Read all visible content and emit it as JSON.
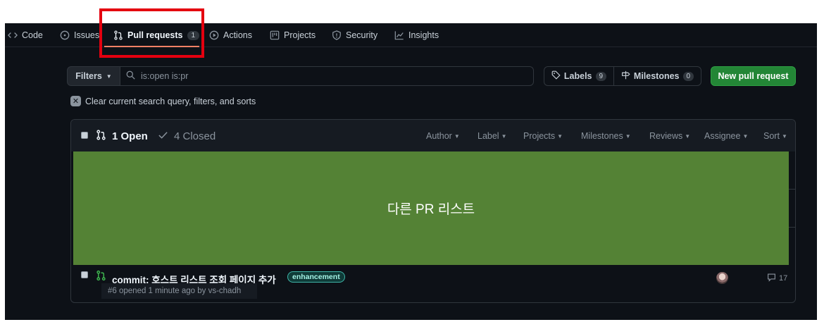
{
  "nav": {
    "items": [
      {
        "label": "Code",
        "icon": "code-icon"
      },
      {
        "label": "Issues",
        "icon": "issue-icon"
      },
      {
        "label": "Pull requests",
        "icon": "pull-request-icon",
        "count": "1",
        "active": true
      },
      {
        "label": "Actions",
        "icon": "play-icon"
      },
      {
        "label": "Projects",
        "icon": "project-icon"
      },
      {
        "label": "Security",
        "icon": "shield-icon"
      },
      {
        "label": "Insights",
        "icon": "graph-icon"
      }
    ]
  },
  "toolbar": {
    "filters_label": "Filters",
    "search_value": "is:open is:pr",
    "labels_label": "Labels",
    "labels_count": "9",
    "milestones_label": "Milestones",
    "milestones_count": "0",
    "new_pr_label": "New pull request"
  },
  "clear_filters": "Clear current search query, filters, and sorts",
  "list": {
    "open_label": "1 Open",
    "closed_label": "4 Closed",
    "filters": [
      "Author",
      "Label",
      "Projects",
      "Milestones",
      "Reviews",
      "Assignee",
      "Sort"
    ],
    "placeholder_text": "다른 PR 리스트",
    "row": {
      "title": "commit: 호스트 리스트 조회 페이지 추가",
      "label": "enhancement",
      "meta": "#6 opened 1 minute ago by vs-chadh",
      "comments": "17"
    }
  },
  "colors": {
    "background": "#0d1117",
    "accent_green": "#238636",
    "highlight_red": "#e4000f",
    "placeholder_green": "#548235"
  }
}
